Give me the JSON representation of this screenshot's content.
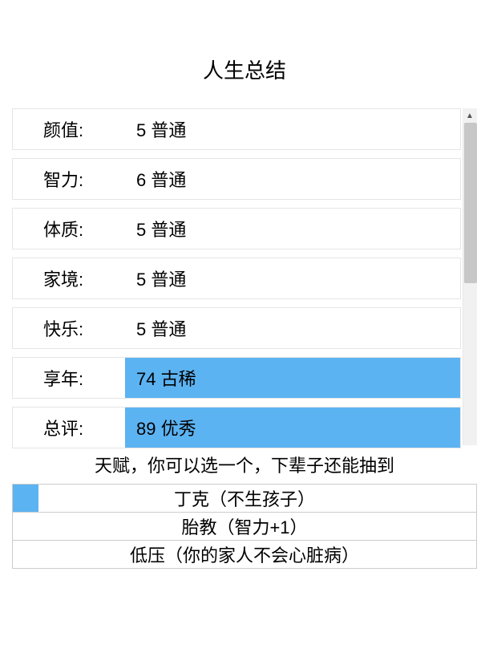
{
  "title": "人生总结",
  "stats": [
    {
      "label": "颜值:",
      "value": "5 普通",
      "highlight": false
    },
    {
      "label": "智力:",
      "value": "6 普通",
      "highlight": false
    },
    {
      "label": "体质:",
      "value": "5 普通",
      "highlight": false
    },
    {
      "label": "家境:",
      "value": "5 普通",
      "highlight": false
    },
    {
      "label": "快乐:",
      "value": "5 普通",
      "highlight": false
    },
    {
      "label": "享年:",
      "value": "74 古稀",
      "highlight": true
    },
    {
      "label": "总评:",
      "value": "89 优秀",
      "highlight": true
    }
  ],
  "talent_heading": "天赋，你可以选一个，下辈子还能抽到",
  "talents": [
    {
      "label": "丁克（不生孩子）",
      "selected": true
    },
    {
      "label": "胎教（智力+1）",
      "selected": false
    },
    {
      "label": "低压（你的家人不会心脏病）",
      "selected": false
    }
  ]
}
